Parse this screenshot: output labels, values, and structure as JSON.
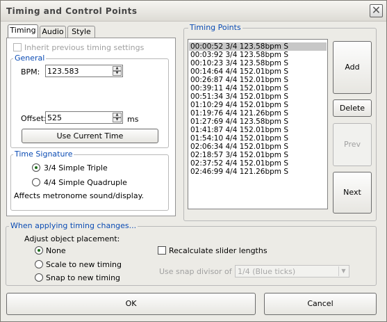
{
  "window": {
    "title": "Timing and Control Points",
    "close_glyph": "✕"
  },
  "tabs": [
    {
      "label": "Timing",
      "active": true
    },
    {
      "label": "Audio",
      "active": false
    },
    {
      "label": "Style",
      "active": false
    }
  ],
  "timing_tab": {
    "inherit_label": "Inherit previous timing settings",
    "inherit_checked": false,
    "general": {
      "legend": "General",
      "bpm_label": "BPM:",
      "bpm_value": "123.583",
      "offset_label": "Offset:",
      "offset_value": "525",
      "offset_unit": "ms",
      "use_current_time_label": "Use Current Time"
    },
    "time_signature": {
      "legend": "Time Signature",
      "options": [
        {
          "label": "3/4 Simple Triple",
          "selected": true
        },
        {
          "label": "4/4 Simple Quadruple",
          "selected": false
        }
      ],
      "note": "Affects metronome sound/display."
    }
  },
  "timing_points": {
    "legend": "Timing Points",
    "items": [
      "00:00:52 3/4 123.58bpm S",
      "00:03:92 3/4 123.58bpm S",
      "00:10:23 3/4 123.58bpm S",
      "00:14:64 4/4 152.01bpm S",
      "00:26:87 4/4 152.01bpm S",
      "00:39:11 4/4 152.01bpm S",
      "00:51:34 3/4 152.01bpm S",
      "01:10:29 4/4 152.01bpm S",
      "01:19:76 4/4 121.26bpm S",
      "01:27:69 4/4 123.58bpm S",
      "01:41:87 4/4 152.01bpm S",
      "01:54:10 4/4 152.01bpm S",
      "02:06:34 4/4 152.01bpm S",
      "02:18:57 3/4 152.01bpm S",
      "02:37:52 4/4 152.01bpm S",
      "02:46:99 4/4 121.26bpm S"
    ],
    "selected_index": 0
  },
  "side_buttons": {
    "add": "Add",
    "delete": "Delete",
    "prev": "Prev",
    "next": "Next"
  },
  "applying": {
    "legend": "When applying timing changes...",
    "adjust_label": "Adjust object placement:",
    "options": [
      {
        "label": "None",
        "selected": true
      },
      {
        "label": "Scale to new timing",
        "selected": false
      },
      {
        "label": "Snap to new timing",
        "selected": false
      }
    ],
    "recalculate_label": "Recalculate slider lengths",
    "recalculate_checked": false,
    "snap_label": "Use snap divisor of",
    "snap_value": "1/4 (Blue ticks)"
  },
  "footer": {
    "ok": "OK",
    "cancel": "Cancel"
  },
  "icons": {
    "spin_up": "▲",
    "spin_down": "▼",
    "combo_arrow": "▼"
  }
}
